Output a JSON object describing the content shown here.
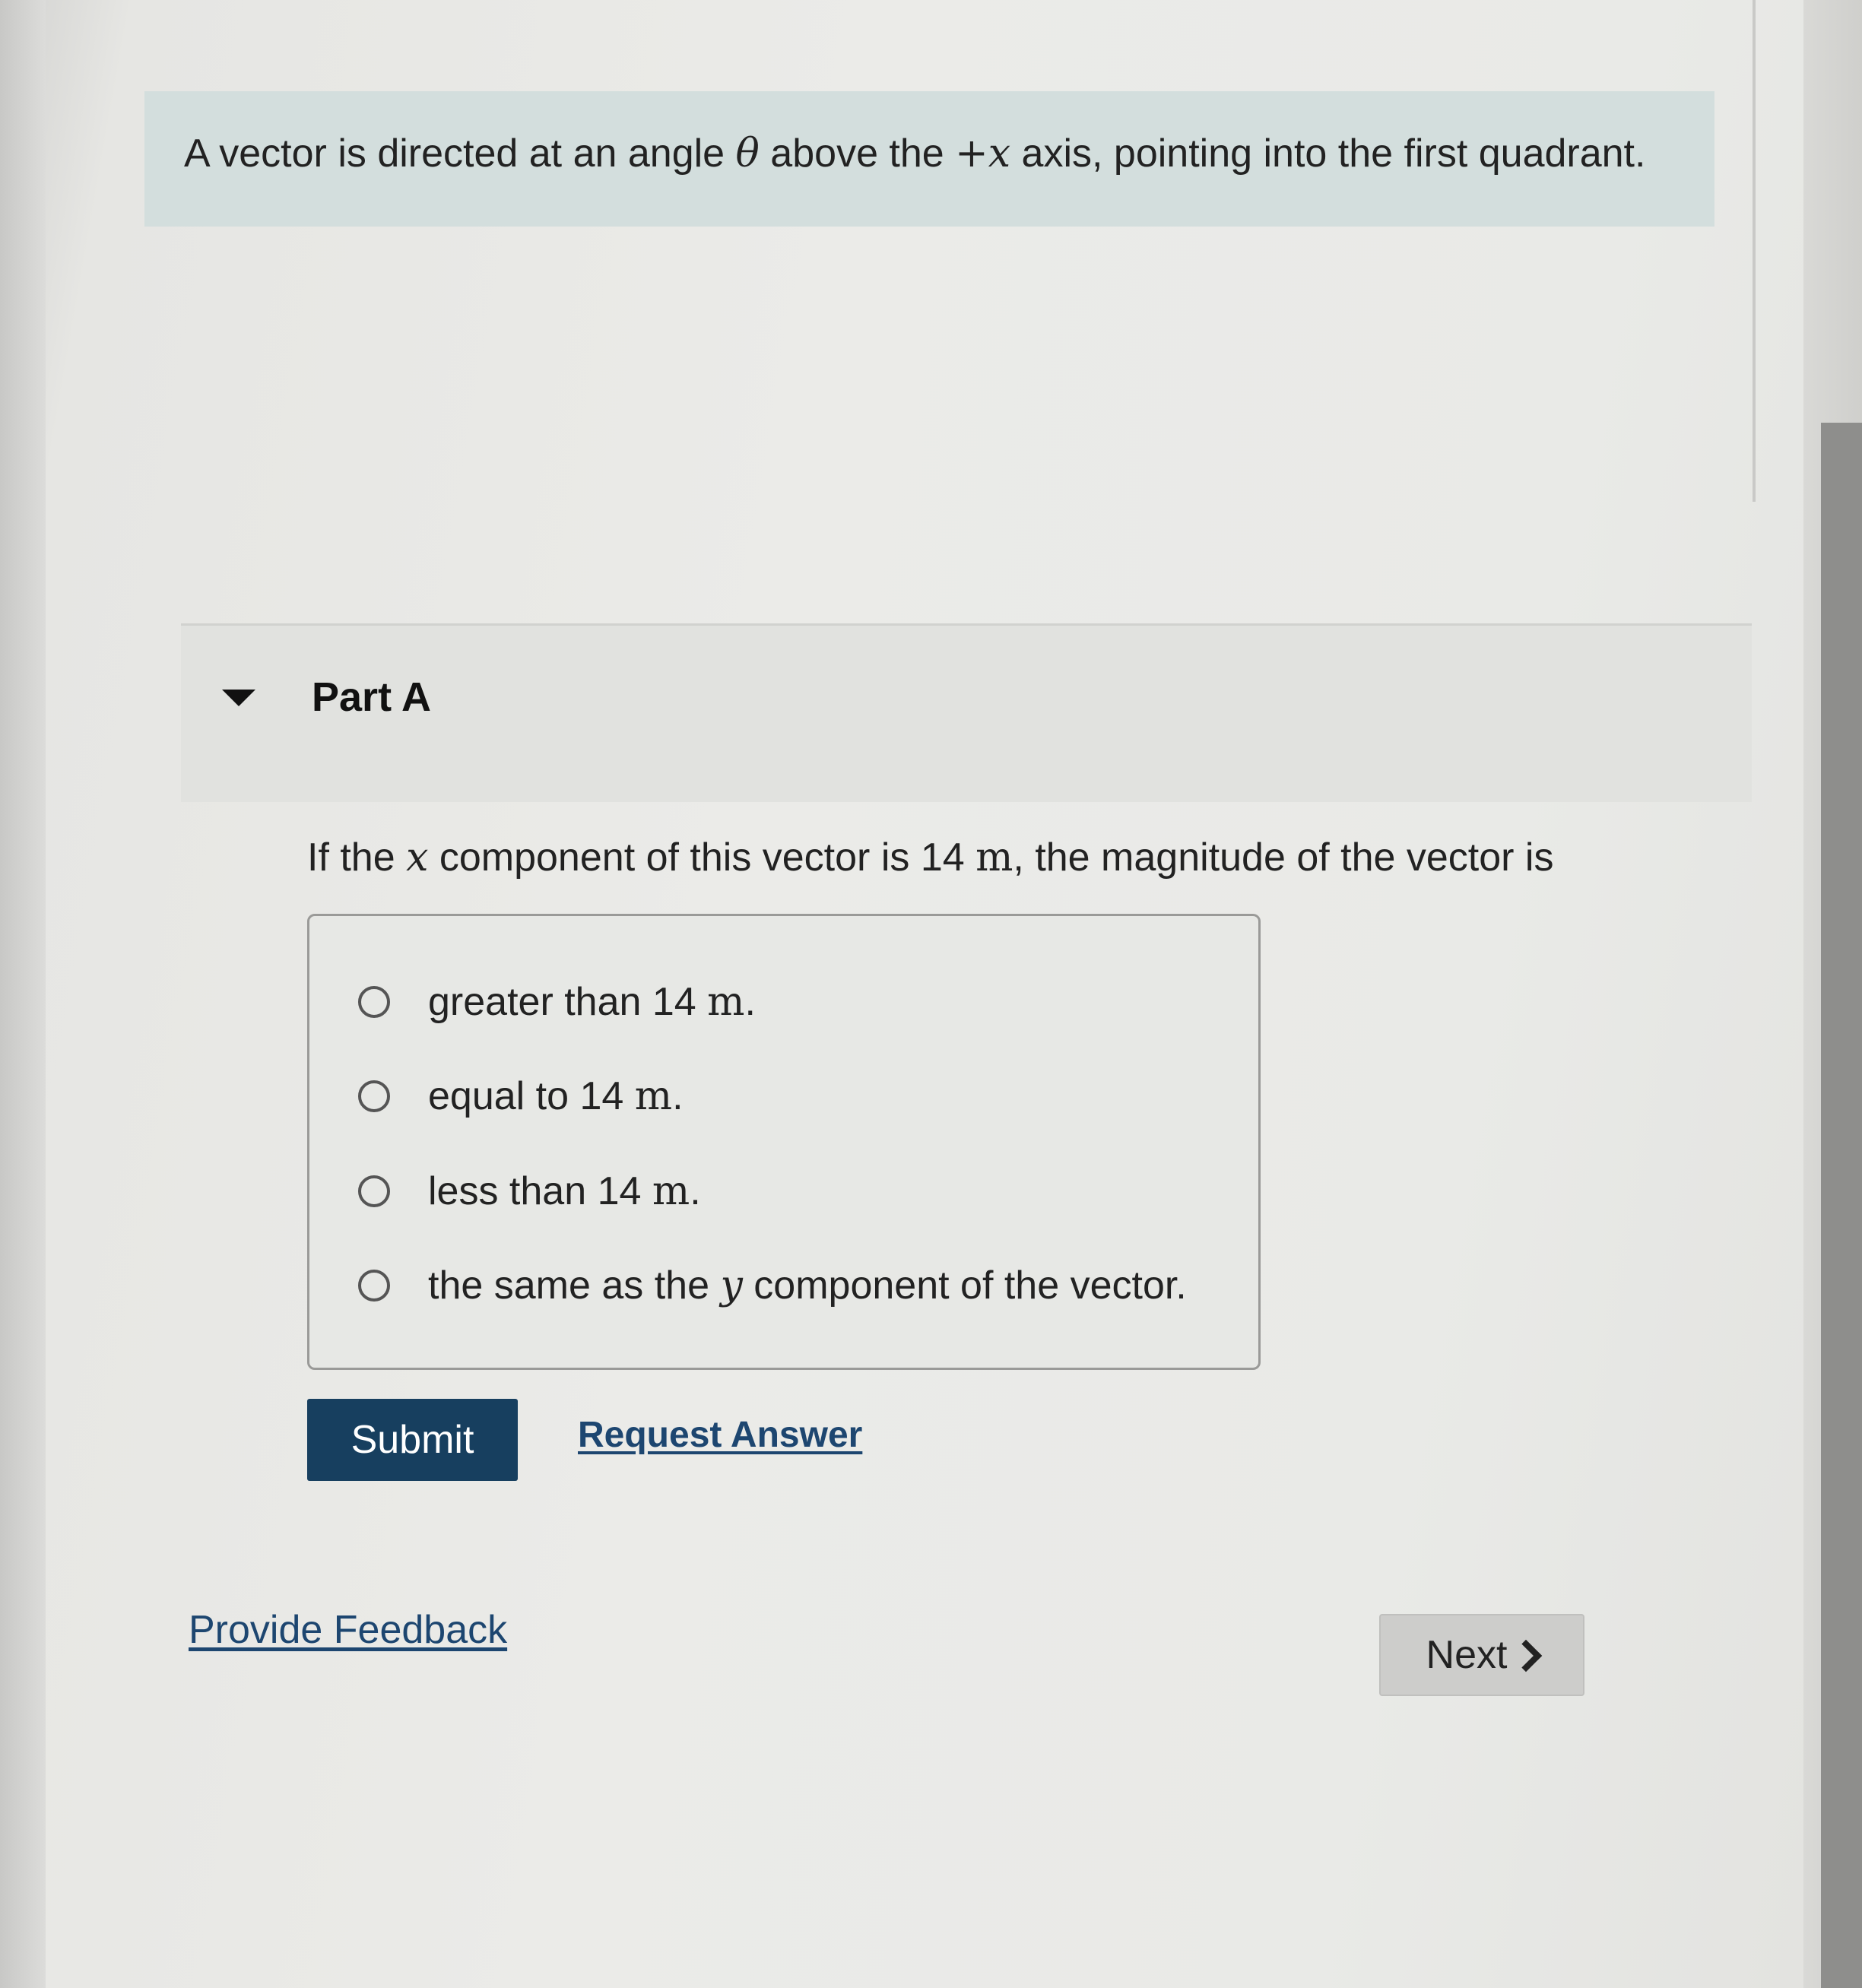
{
  "intro": {
    "text_before_theta": "A vector is directed at an angle ",
    "theta": "θ",
    "text_between": " above the ",
    "axis_symbol": "+x",
    "text_after": " axis, pointing into the first quadrant."
  },
  "part": {
    "title": "Part A",
    "question_before_x": "If the ",
    "x_symbol": "x",
    "question_middle": " component of this vector is 14 ",
    "unit": "m",
    "question_after": ", the magnitude of the vector is"
  },
  "options": [
    {
      "before": "greater than 14 ",
      "unit": "m",
      "after": "."
    },
    {
      "before": "equal to 14 ",
      "unit": "m",
      "after": "."
    },
    {
      "before": "less than 14 ",
      "unit": "m",
      "after": "."
    },
    {
      "before": "the same as the ",
      "unit": "y",
      "after": " component of the vector."
    }
  ],
  "actions": {
    "submit_label": "Submit",
    "request_answer_label": "Request Answer"
  },
  "footer": {
    "feedback_label": "Provide Feedback",
    "next_label": "Next"
  },
  "colors": {
    "submit_bg": "#173f5f",
    "link": "#1d4670",
    "intro_bg": "#d3dedd"
  }
}
